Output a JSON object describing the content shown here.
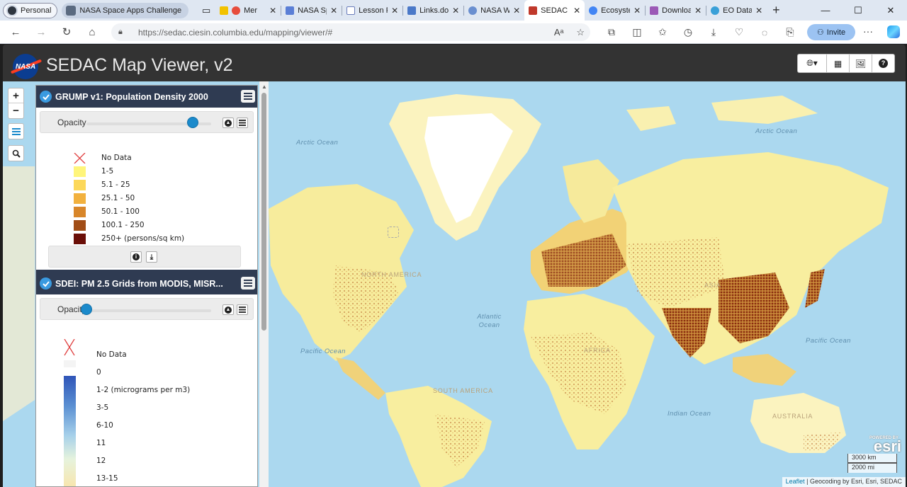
{
  "browser": {
    "profile_label": "Personal",
    "tab_group_label": "NASA Space Apps Challenge",
    "tabs": [
      {
        "title": "Mer",
        "color": "#e74c3c"
      },
      {
        "title": "NASA Sp",
        "color": "#5b7fd6"
      },
      {
        "title": "Lesson P",
        "color": "#6a7dbb"
      },
      {
        "title": "Links.do",
        "color": "#4a78c8"
      },
      {
        "title": "NASA W",
        "color": "#6a8fd0"
      },
      {
        "title": "SEDAC M",
        "color": "#c0392b"
      },
      {
        "title": "Ecosyste",
        "color": "#4285f4"
      },
      {
        "title": "Downloa",
        "color": "#9b59b6"
      },
      {
        "title": "EO Data",
        "color": "#3aa0d8"
      }
    ],
    "url": "https://sedac.ciesin.columbia.edu/mapping/viewer/#",
    "invite_label": "Invite"
  },
  "app": {
    "title": "SEDAC Map Viewer, v2"
  },
  "layers": [
    {
      "title": "GRUMP v1: Population Density 2000",
      "opacity_label": "Opacity",
      "opacity": 0.85,
      "legend": [
        {
          "label": "No Data",
          "color": "none"
        },
        {
          "label": "1-5",
          "color": "#fff57a"
        },
        {
          "label": "5.1 - 25",
          "color": "#fcd85a"
        },
        {
          "label": "25.1 - 50",
          "color": "#f2b13e"
        },
        {
          "label": "50.1 - 100",
          "color": "#d8862a"
        },
        {
          "label": "100.1 - 250",
          "color": "#a14d16"
        },
        {
          "label": "250+ (persons/sq km)",
          "color": "#6b0f08"
        }
      ]
    },
    {
      "title": "SDEI: PM 2.5 Grids from MODIS, MISR...",
      "opacity_label": "Opacity",
      "opacity": 0.0,
      "legend": [
        {
          "label": "No Data"
        },
        {
          "label": "0"
        },
        {
          "label": "1-2 (micrograms per m3)"
        },
        {
          "label": "3-5"
        },
        {
          "label": "6-10"
        },
        {
          "label": "11"
        },
        {
          "label": "12"
        },
        {
          "label": "13-15"
        }
      ]
    }
  ],
  "map": {
    "ocean_labels": [
      "Arctic Ocean",
      "Arctic Ocean",
      "Atlantic Ocean",
      "Pacific Ocean",
      "Pacific Ocean",
      "Indian Ocean"
    ],
    "land_labels": [
      "NORTH AMERICA",
      "AFRICA",
      "ASIA",
      "SOUTH AMERICA",
      "AUSTRALIA"
    ],
    "esri_small": "POWERED BY",
    "esri": "esri",
    "scale_km": "3000 km",
    "scale_mi": "2000 mi",
    "attribution_link": "Leaflet",
    "attribution_text": " | Geocoding by Esri, Esri, SEDAC"
  }
}
